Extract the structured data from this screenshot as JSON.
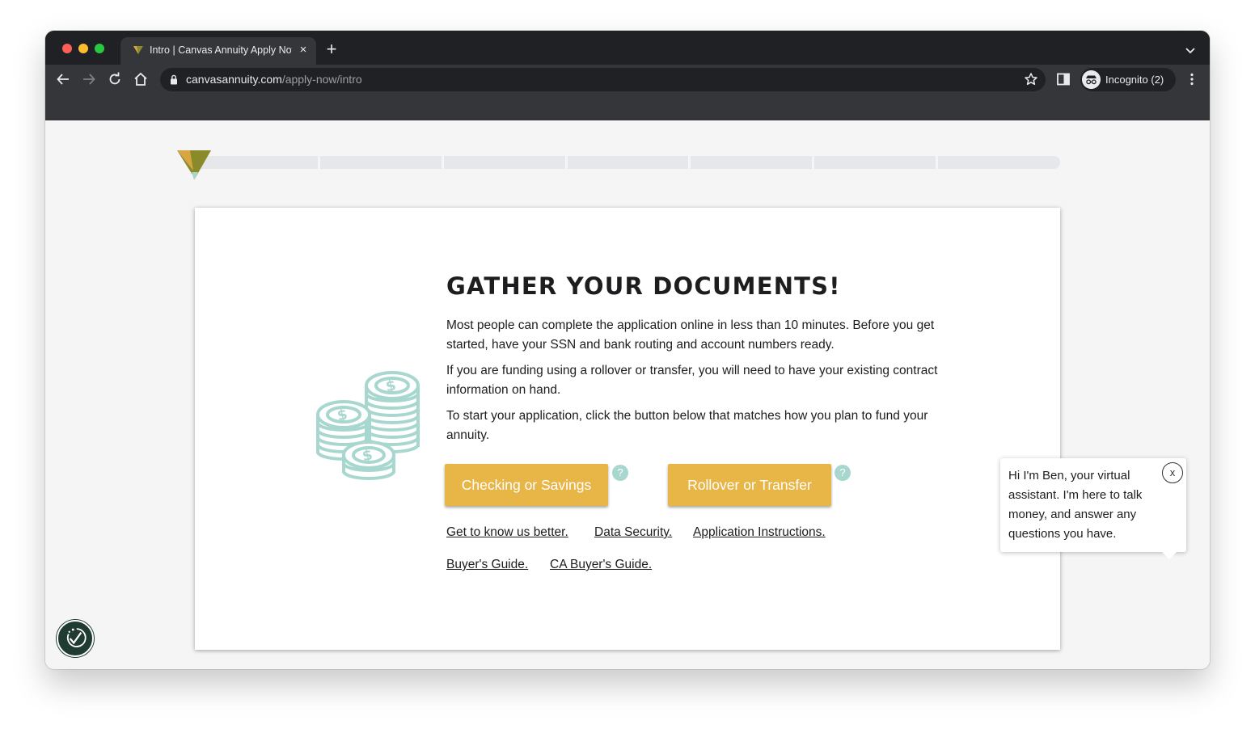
{
  "browser": {
    "tab_title": "Intro | Canvas Annuity Apply Now",
    "url_host": "canvasannuity.com",
    "url_path": "/apply-now/intro",
    "profile_label": "Incognito (2)"
  },
  "progress": {
    "segments": 7,
    "completed": 0
  },
  "main": {
    "heading": "GATHER YOUR DOCUMENTS!",
    "paragraphs": [
      "Most people can complete the application online in less than 10 minutes. Before you get started, have your SSN and bank routing and account numbers ready.",
      "If you are funding using a rollover or transfer, you will need to have your existing contract information on hand.",
      "To start your application, click the button below that matches how you plan to fund your annuity."
    ],
    "buttons": [
      {
        "label": "Checking or Savings",
        "help": "?"
      },
      {
        "label": "Rollover or Transfer",
        "help": "?"
      }
    ],
    "links": [
      "Get to know us better.",
      "Data Security.",
      "Application Instructions.",
      "Buyer's Guide.",
      "CA Buyer's Guide."
    ]
  },
  "chat": {
    "message": "Hi I'm Ben, your virtual assistant. I'm here to talk money, and answer any questions you have.",
    "close_label": "x"
  },
  "colors": {
    "accent_button": "#e8b547",
    "coin_icon": "#a8d7cf",
    "logo_olive": "#8a8a2a",
    "logo_gold": "#d7a642",
    "accessibility_badge": "#1f3b32"
  },
  "icons": {
    "hero": "coins-stack-icon",
    "accessibility": "accessibility-check-icon"
  }
}
